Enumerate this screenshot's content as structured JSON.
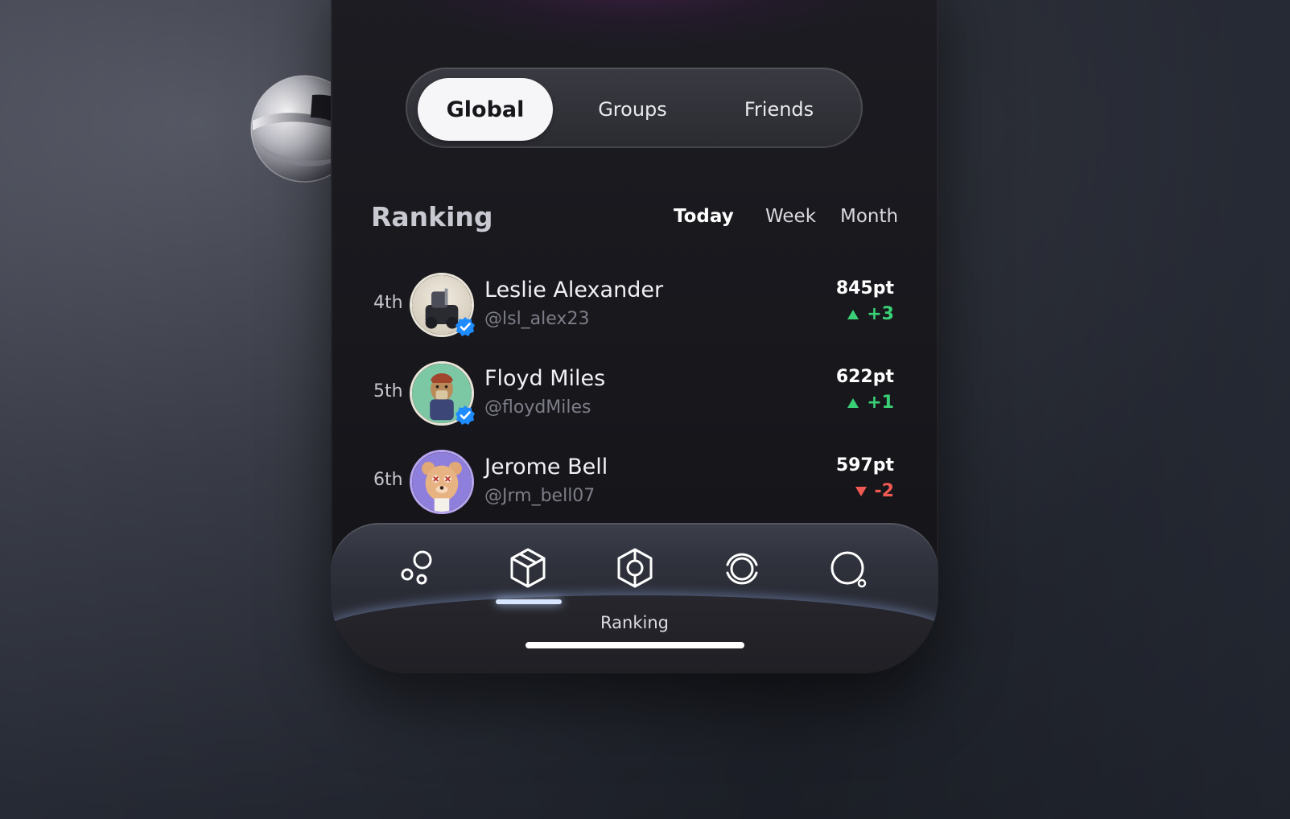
{
  "tabs": [
    {
      "label": "Global",
      "active": true
    },
    {
      "label": "Groups",
      "active": false
    },
    {
      "label": "Friends",
      "active": false
    }
  ],
  "ranking": {
    "title": "Ranking",
    "periods": [
      {
        "label": "Today",
        "active": true
      },
      {
        "label": "Week",
        "active": false
      },
      {
        "label": "Month",
        "active": false
      }
    ],
    "rows": [
      {
        "rank": "4th",
        "name": "Leslie Alexander",
        "handle": "@lsl_alex23",
        "points": "845pt",
        "delta": "+3",
        "trend": "up",
        "verified": true
      },
      {
        "rank": "5th",
        "name": "Floyd Miles",
        "handle": "@floydMiles",
        "points": "622pt",
        "delta": "+1",
        "trend": "up",
        "verified": true
      },
      {
        "rank": "6th",
        "name": "Jerome Bell",
        "handle": "@Jrm_bell07",
        "points": "597pt",
        "delta": "-2",
        "trend": "down",
        "verified": false
      }
    ]
  },
  "nav": {
    "items": [
      {
        "icon": "bubbles-icon",
        "active": false
      },
      {
        "icon": "cube-icon",
        "active": true
      },
      {
        "icon": "hexagon-target-icon",
        "active": false
      },
      {
        "icon": "ring-icon",
        "active": false
      },
      {
        "icon": "search-icon",
        "active": false
      }
    ],
    "active_label": "Ranking"
  },
  "colors": {
    "up": "#3ad176",
    "down": "#f05a52",
    "verified": "#1e8bff",
    "background": "#2b2e37"
  }
}
